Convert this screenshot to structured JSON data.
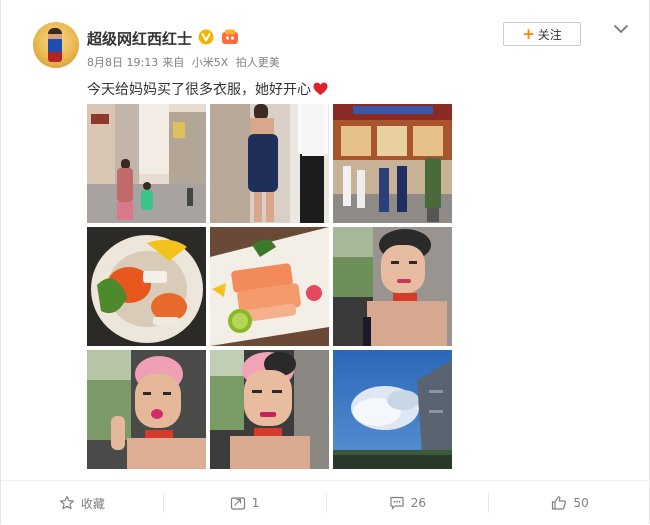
{
  "post": {
    "username": "超级网红西红士",
    "verified_icon": "yellow-v-badge",
    "level_icon": "vip-level-icon",
    "date": "8月8日 19:13",
    "source_prefix": "来自",
    "source_device": "小米5X",
    "source_suffix": "拍人更美",
    "text": "今天给妈妈买了很多衣服，她好开心",
    "heart_icon": "red-heart-emoji"
  },
  "follow_button": {
    "plus": "+",
    "label": "关注"
  },
  "photos": [
    {
      "name": "street-mother-child"
    },
    {
      "name": "woman-blue-dress"
    },
    {
      "name": "store-front-group"
    },
    {
      "name": "sashimi-roe-plate"
    },
    {
      "name": "salmon-sashimi-lime"
    },
    {
      "name": "car-selfie-1"
    },
    {
      "name": "car-selfie-kiss"
    },
    {
      "name": "car-selfie-2"
    },
    {
      "name": "sky-cloud"
    }
  ],
  "footer": {
    "favorite_label": "收藏",
    "repost_count": "1",
    "comment_count": "26",
    "like_count": "50"
  },
  "colors": {
    "accent_orange": "#ff8200",
    "text_main": "#333333",
    "text_meta": "#808080",
    "heart_red": "#e0202a"
  }
}
